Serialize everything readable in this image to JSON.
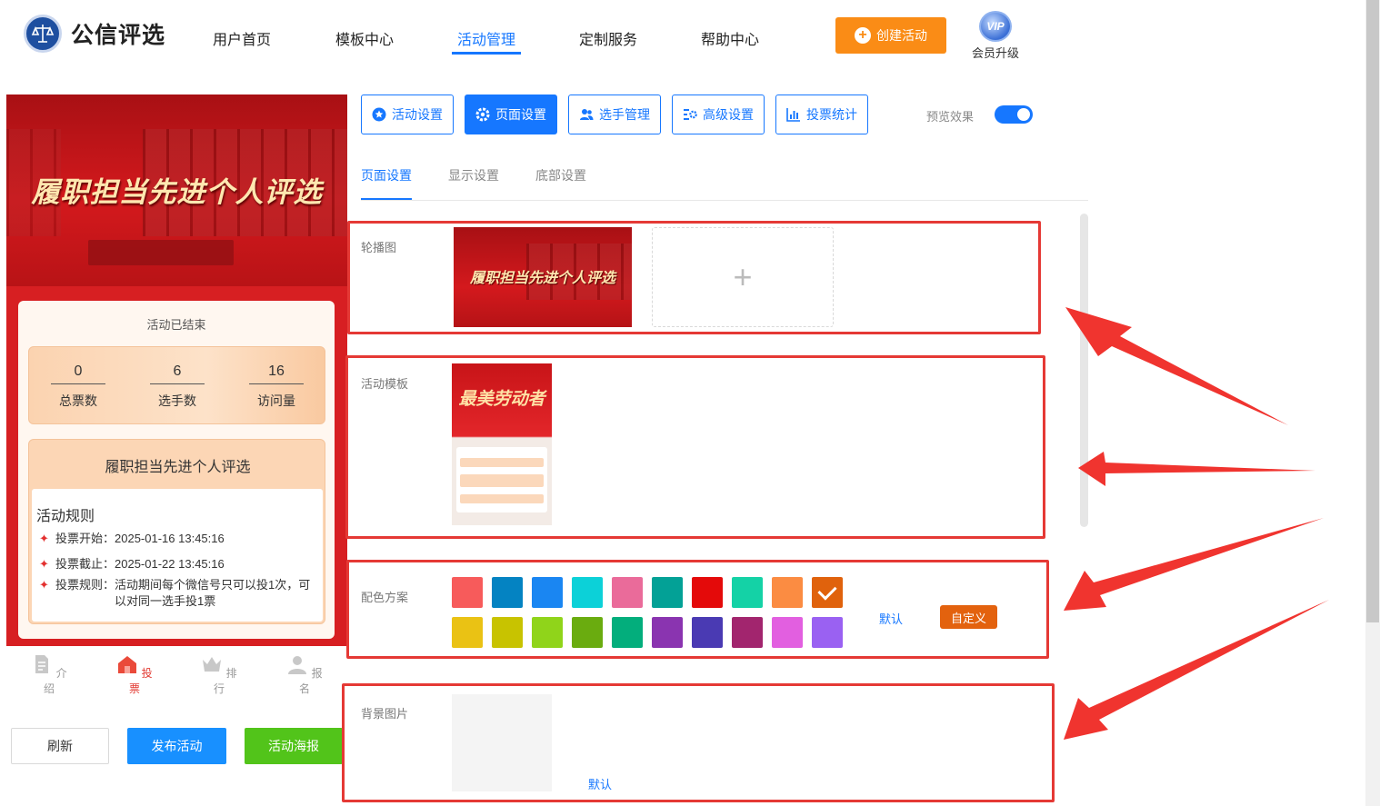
{
  "brand": {
    "name": "公信评选"
  },
  "nav": [
    "用户首页",
    "模板中心",
    "活动管理",
    "定制服务",
    "帮助中心"
  ],
  "header": {
    "create_label": "创建活动",
    "vip_badge": "VIP",
    "vip_label": "会员升级"
  },
  "preview": {
    "banner_title": "履职担当先进个人评选",
    "status": "活动已结束",
    "stats": [
      {
        "value": "0",
        "label": "总票数"
      },
      {
        "value": "6",
        "label": "选手数"
      },
      {
        "value": "16",
        "label": "访问量"
      }
    ],
    "event_name": "履职担当先进个人评选",
    "rules_title": "活动规则",
    "rules": [
      {
        "key": "投票开始：",
        "value": "2025-01-16 13:45:16"
      },
      {
        "key": "投票截止：",
        "value": "2025-01-22 13:45:16"
      },
      {
        "key": "投票规则：",
        "value": "活动期间每个微信号只可以投1次，可以对同一选手投1票"
      }
    ],
    "tabs": [
      "介绍",
      "投票",
      "排行",
      "报名"
    ],
    "active_tab": "投票",
    "buttons": {
      "refresh": "刷新",
      "publish": "发布活动",
      "poster": "活动海报"
    }
  },
  "settings": {
    "top_tabs": [
      "活动设置",
      "页面设置",
      "选手管理",
      "高级设置",
      "投票统计"
    ],
    "active_top_tab": "页面设置",
    "preview_toggle_label": "预览效果",
    "preview_toggle_on": true,
    "sub_tabs": [
      "页面设置",
      "显示设置",
      "底部设置"
    ],
    "active_sub_tab": "页面设置",
    "carousel": {
      "label": "轮播图",
      "image_text": "履职担当先进个人评选",
      "add_icon": "plus-icon"
    },
    "template": {
      "label": "活动模板",
      "thumb_title": "最美劳动者"
    },
    "color": {
      "label": "配色方案",
      "row1": [
        "#f75b5b",
        "#0483c2",
        "#1a86f2",
        "#0cd1d8",
        "#ea6b9a",
        "#03a196",
        "#e40a0a",
        "#14d2a6",
        "#fb8c42",
        "#e0620c"
      ],
      "row2": [
        "#eac214",
        "#c8c300",
        "#90d41a",
        "#6aac0f",
        "#03ae7c",
        "#8a34b0",
        "#4a3ab3",
        "#a2256e",
        "#e25fe0",
        "#9a61f2"
      ],
      "selected": "#e0620c",
      "default_label": "默认",
      "custom_label": "自定义"
    },
    "background": {
      "label": "背景图片",
      "default_label": "默认"
    }
  },
  "colors": {
    "primary": "#1677ff",
    "orange": "#fa8c16",
    "red_annotation": "#e53935",
    "publish": "#1890ff",
    "poster": "#52c41a"
  }
}
